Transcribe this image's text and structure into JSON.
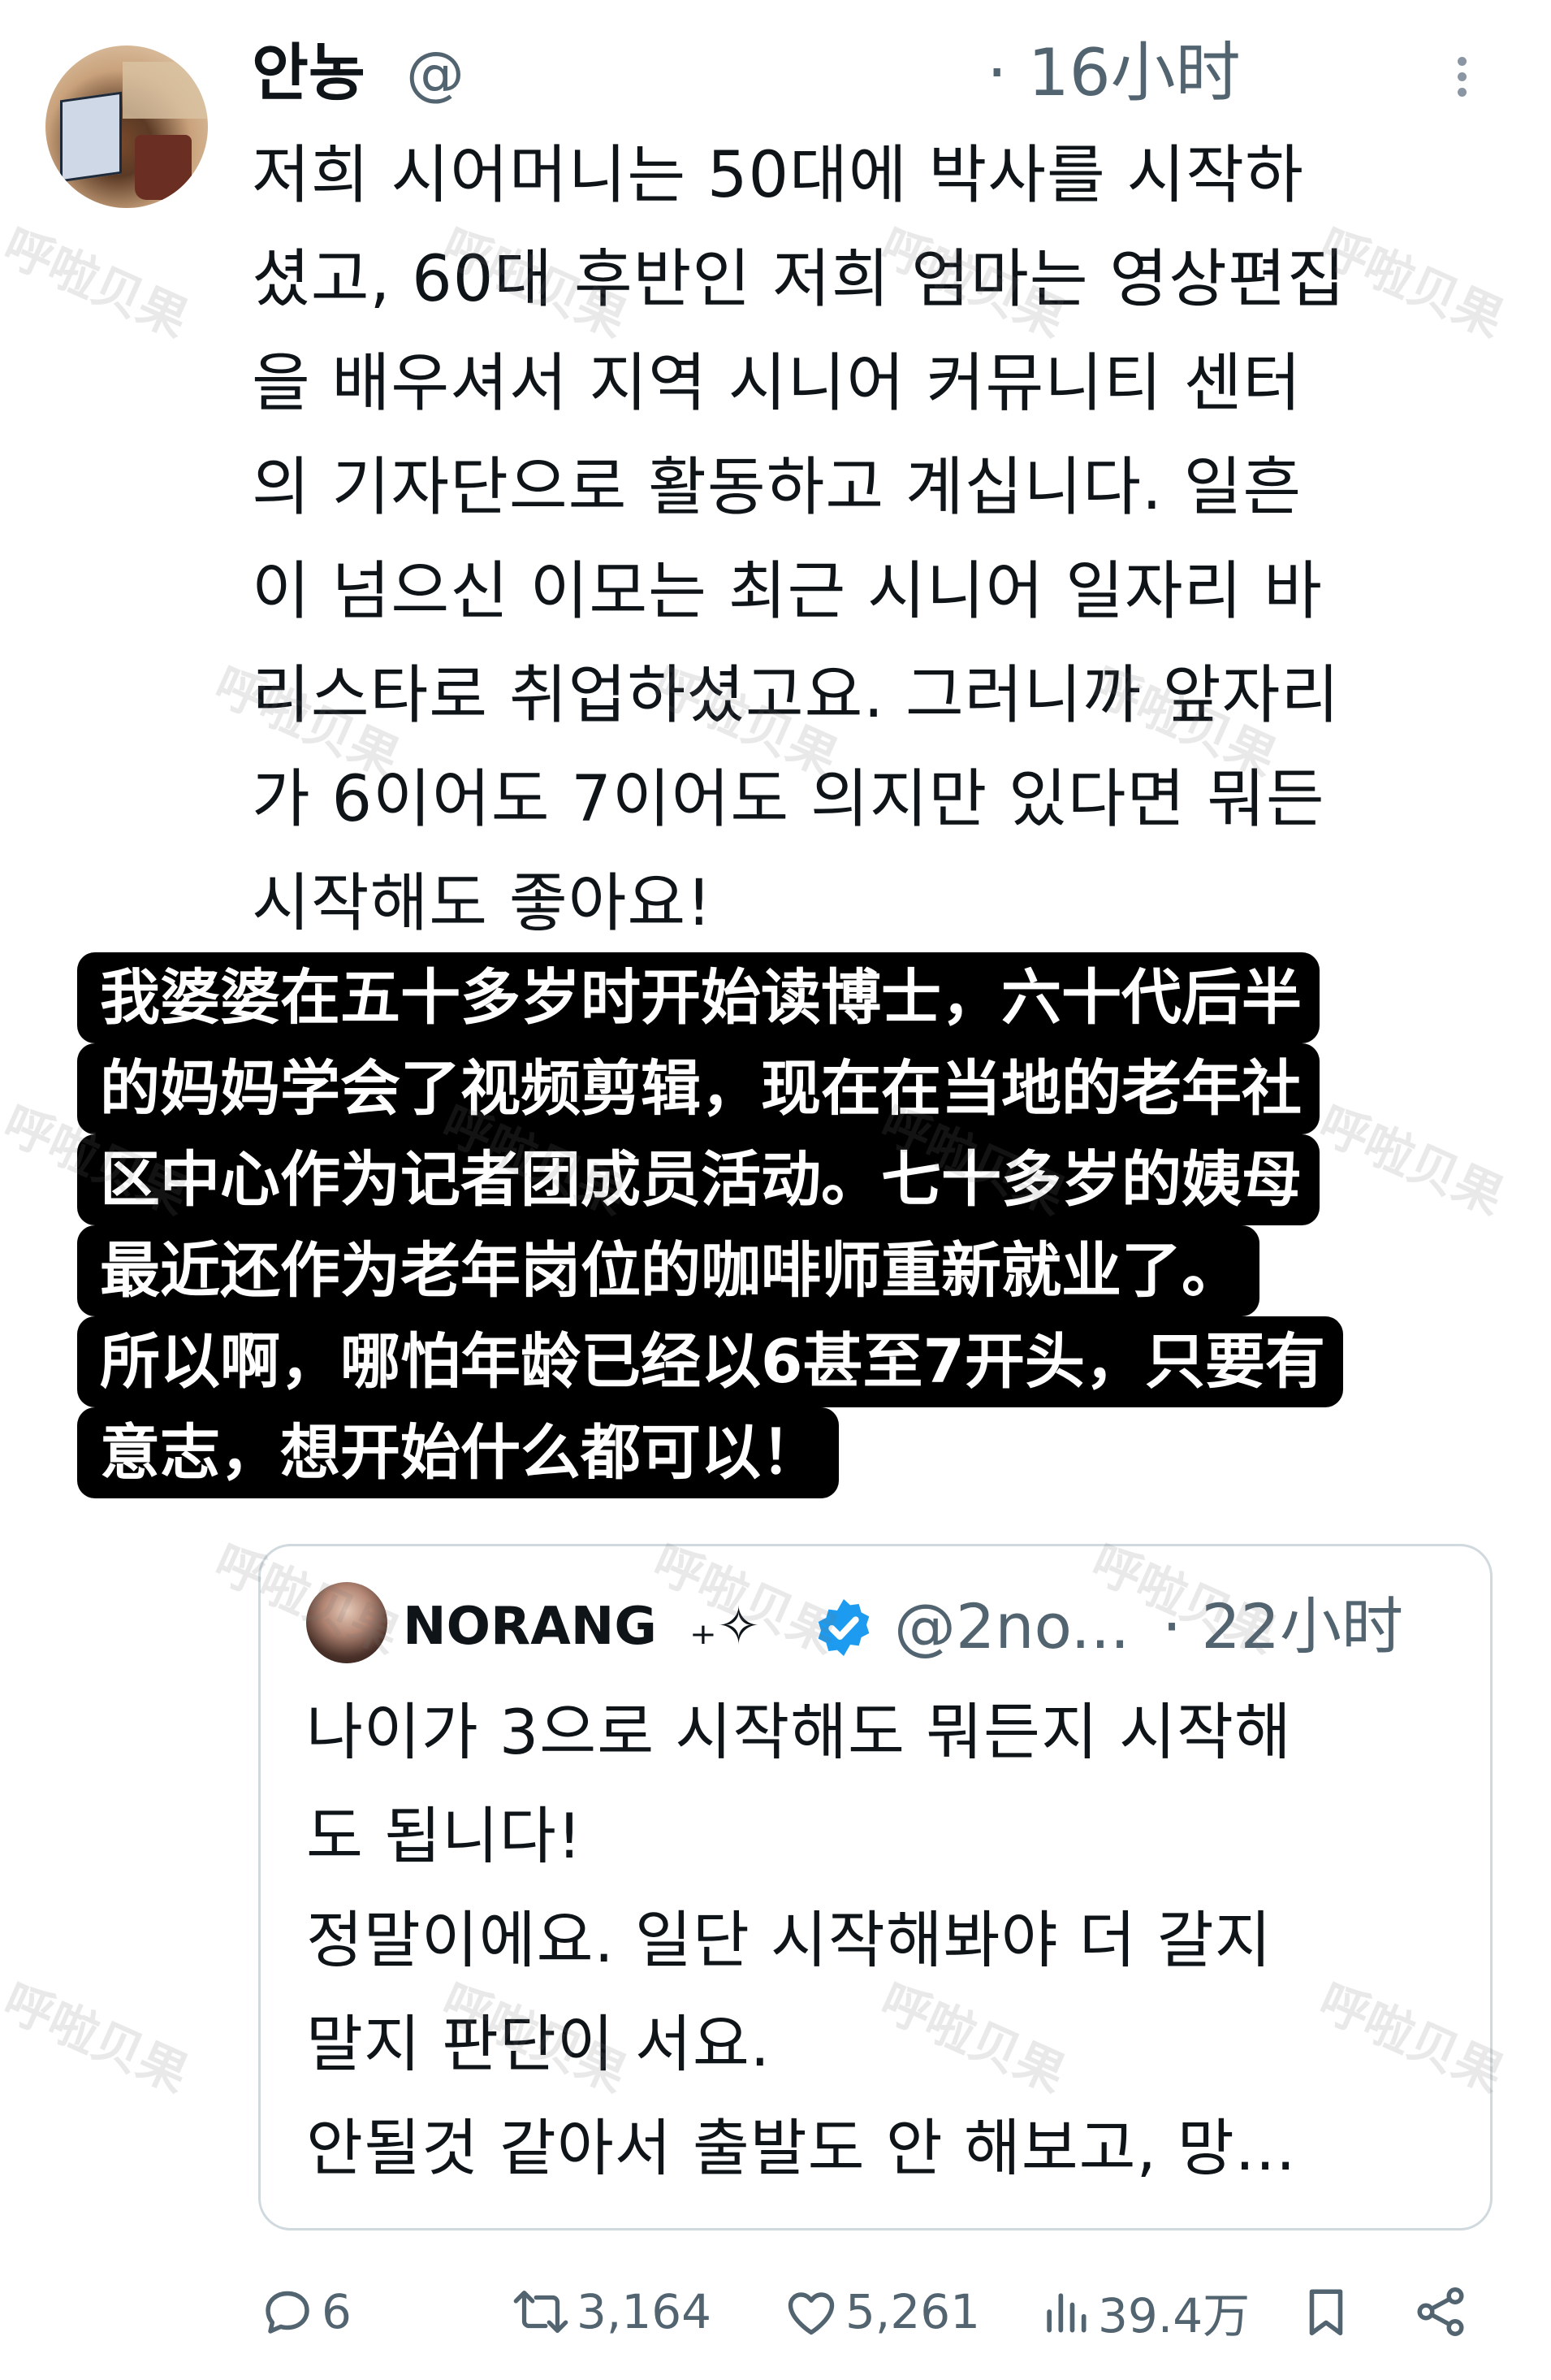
{
  "author": {
    "name": "안농",
    "handle": "@",
    "time": "· 16小时"
  },
  "tweet": {
    "text": "저희 시어머니는 50대에 박사를 시작하\n셨고, 60대 후반인 저희 엄마는 영상편집\n을 배우셔서 지역 시니어 커뮤니티 센터\n의 기자단으로 활동하고 계십니다. 일흔\n이 넘으신 이모는 최근 시니어 일자리 바\n리스타로 취업하셨고요. 그러니까 앞자리\n가 6이어도 7이어도 의지만 있다면 뭐든\n시작해도 좋아요!"
  },
  "caption": {
    "lines": [
      "我婆婆在五十多岁时开始读博士，六十代后半",
      "的妈妈学会了视频剪辑，现在在当地的老年社",
      "区中心作为记者团成员活动。七十多岁的姨母",
      "最近还作为老年岗位的咖啡师重新就业了。",
      "所以啊，哪怕年龄已经以6甚至7开头，只要有",
      "意志，想开始什么都可以！"
    ]
  },
  "quote": {
    "name": "NORANG",
    "suffix": "₊✧",
    "handle": "@2no...",
    "time": "· 22小时",
    "text": "나이가 3으로 시작해도 뭐든지 시작해\n도 됩니다!\n정말이에요. 일단 시작해봐야 더 갈지\n말지 판단이 서요.\n안될것 같아서 출발도 안 해보고, 망..."
  },
  "actions": {
    "replies": "6",
    "retweets": "3,164",
    "likes": "5,261",
    "views": "39.4万"
  },
  "watermark": "呼啦贝果",
  "colors": {
    "text": "#0f1419",
    "muted": "#536471",
    "verified": "#1d9bf0",
    "caption_bg": "#000000",
    "caption_text": "#ffffff"
  }
}
